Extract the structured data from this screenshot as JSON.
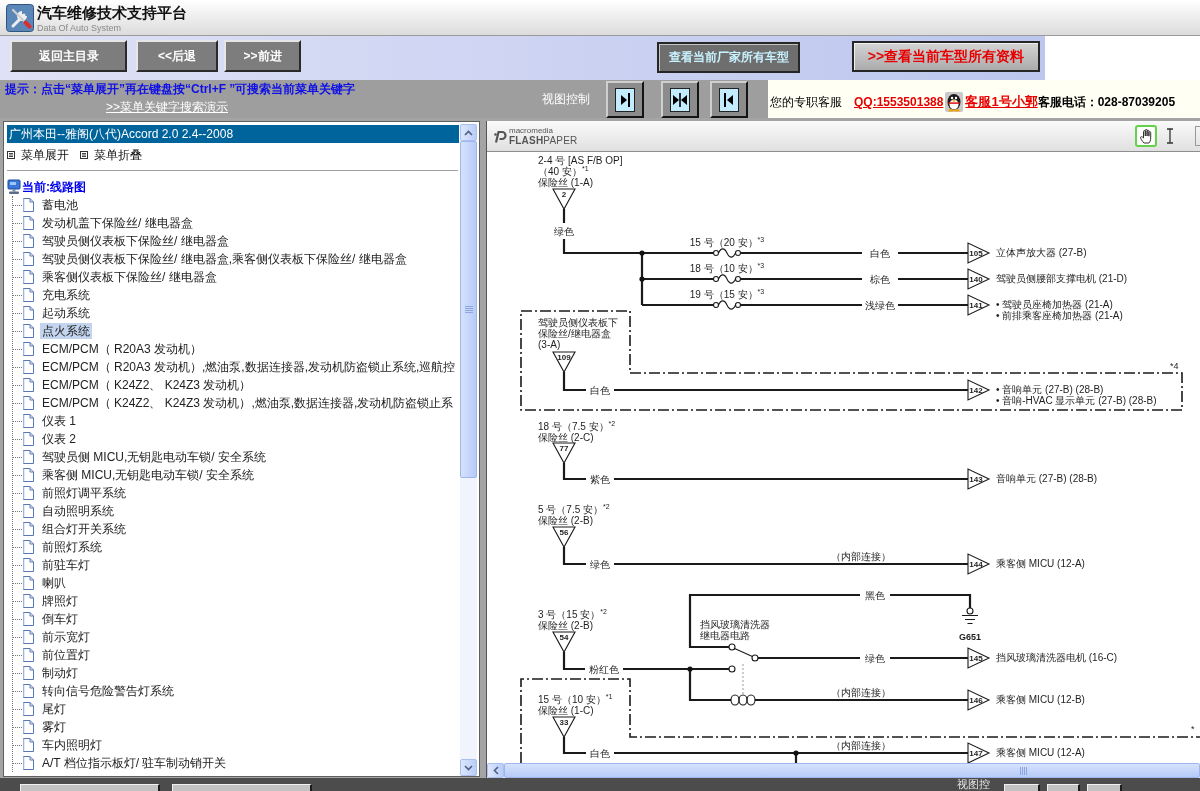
{
  "header": {
    "title": "汽车维修技术支持平台",
    "subtitle": "Data Of Auto System"
  },
  "nav": {
    "buttons": [
      "返回主目录",
      "<<后退",
      ">>前进"
    ],
    "links": [
      {
        "label": "查看当前厂家所有车型",
        "kind": "plain"
      },
      {
        "label": ">>查看当前车型所有资料",
        "kind": "highlight"
      }
    ]
  },
  "tip": {
    "text": "提示：点击“菜单展开”再在键盘按“Ctrl+F ”可搜索当前菜单关键字",
    "demo_link": ">>菜单关键字搜索演示"
  },
  "view_control": {
    "label": "视图控制",
    "buttons": [
      {
        "kind": "right"
      },
      {
        "kind": "center"
      },
      {
        "kind": "left"
      }
    ]
  },
  "support": {
    "label": "您的专职客服",
    "qq": "QQ:1553501388",
    "agent": "客服1号小郭",
    "phone_label": "客服电话：",
    "phone": "028-87039205"
  },
  "menu_panel": {
    "title": "广州本田--雅阁(八代)Accord 2.0 2.4--2008",
    "actions": [
      "菜单展开",
      "菜单折叠"
    ],
    "tree": {
      "label": "当前:线路图",
      "children": [
        {
          "label": "蓄电池",
          "selected": false
        },
        {
          "label": "发动机盖下保险丝/ 继电器盒",
          "selected": false
        },
        {
          "label": "驾驶员侧仪表板下保险丝/ 继电器盒",
          "selected": false
        },
        {
          "label": "驾驶员侧仪表板下保险丝/ 继电器盒,乘客侧仪表板下保险丝/ 继电器盒",
          "selected": false
        },
        {
          "label": "乘客侧仪表板下保险丝/ 继电器盒",
          "selected": false
        },
        {
          "label": "充电系统",
          "selected": false
        },
        {
          "label": "起动系统",
          "selected": false
        },
        {
          "label": "点火系统",
          "selected": true
        },
        {
          "label": "ECM/PCM（ R20A3 发动机）",
          "selected": false
        },
        {
          "label": "ECM/PCM（ R20A3 发动机）,燃油泵,数据连接器,发动机防盗锁止系统,巡航控",
          "selected": false
        },
        {
          "label": "ECM/PCM（ K24Z2、 K24Z3 发动机）",
          "selected": false
        },
        {
          "label": "ECM/PCM（ K24Z2、 K24Z3 发动机）,燃油泵,数据连接器,发动机防盗锁止系",
          "selected": false
        },
        {
          "label": "仪表 1",
          "selected": false
        },
        {
          "label": "仪表 2",
          "selected": false
        },
        {
          "label": "驾驶员侧 MICU,无钥匙电动车锁/ 安全系统",
          "selected": false
        },
        {
          "label": "乘客侧 MICU,无钥匙电动车锁/ 安全系统",
          "selected": false
        },
        {
          "label": "前照灯调平系统",
          "selected": false
        },
        {
          "label": "自动照明系统",
          "selected": false
        },
        {
          "label": "组合灯开关系统",
          "selected": false
        },
        {
          "label": "前照灯系统",
          "selected": false
        },
        {
          "label": "前驻车灯",
          "selected": false
        },
        {
          "label": "喇叭",
          "selected": false
        },
        {
          "label": "牌照灯",
          "selected": false
        },
        {
          "label": "倒车灯",
          "selected": false
        },
        {
          "label": "前示宽灯",
          "selected": false
        },
        {
          "label": "前位置灯",
          "selected": false
        },
        {
          "label": "制动灯",
          "selected": false
        },
        {
          "label": "转向信号危险警告灯系统",
          "selected": false
        },
        {
          "label": "尾灯",
          "selected": false
        },
        {
          "label": "雾灯",
          "selected": false
        },
        {
          "label": "车内照明灯",
          "selected": false
        },
        {
          "label": "A/T 档位指示板灯/ 驻车制动销开关",
          "selected": false
        }
      ]
    }
  },
  "viewer": {
    "brand": {
      "top": "macromedia",
      "bottom": "**FLASH**PAPER"
    },
    "tools": [
      {
        "kind": "hand",
        "selected": true
      },
      {
        "kind": "text",
        "selected": false
      }
    ],
    "diagram": {
      "sources": [
        {
          "lines": [
            "2-4 号 [AS F/B OP]",
            "（40 安）$^{*1}$",
            "保险丝 (1-A)"
          ],
          "pin": "2",
          "wire_color": "绿色"
        },
        {
          "lines": [
            "驾驶员侧仪表板下",
            "保险丝/继电器盒",
            "(3-A)"
          ],
          "pin": "109",
          "wire_color": "白色"
        },
        {
          "lines": [
            "18 号（7.5 安）$^{*2}$",
            "保险丝 (2-C)"
          ],
          "pin": "77",
          "wire_color": "紫色"
        },
        {
          "lines": [
            "5 号（7.5 安）$^{*2}$",
            "保险丝 (2-B)"
          ],
          "pin": "56",
          "wire_color": "绿色"
        },
        {
          "lines": [
            "3 号（15 安）$^{*2}$",
            "保险丝 (2-B)"
          ],
          "pin": "54",
          "wire_color": "粉红色"
        },
        {
          "lines": [
            "15 号（10 安）$^{*1}$",
            "保险丝 (1-C)"
          ],
          "pin": "33",
          "wire_color": "白色"
        }
      ],
      "branch_fuses": [
        "15 号（20 安）$^{*3}$",
        "18 号（10 安）$^{*3}$",
        "19 号（15 安）$^{*3}$"
      ],
      "outputs": [
        {
          "pin": "105",
          "wire_color": "白色",
          "loads": [
            "立体声放大器 (27-B)"
          ]
        },
        {
          "pin": "140",
          "wire_color": "棕色",
          "loads": [
            "驾驶员侧腰部支撑电机 (21-D)"
          ]
        },
        {
          "pin": "141",
          "wire_color": "浅绿色",
          "loads": [
            "• 驾驶员座椅加热器 (21-A)",
            "• 前排乘客座椅加热器 (21-A)"
          ]
        },
        {
          "pin": "142",
          "loads": [
            "• 音响单元 (27-B) (28-B)",
            "• 音响-HVAC 显示单元 (27-B) (28-B)"
          ]
        },
        {
          "pin": "143",
          "loads": [
            "音响单元 (27-B) (28-B)"
          ]
        },
        {
          "pin": "144",
          "note": "（内部连接）",
          "loads": [
            "乘客侧 MICU (12-A)"
          ]
        },
        {
          "pin": "145",
          "wire_color": "绿色",
          "loads": [
            "挡风玻璃清洗器电机 (16-C)"
          ]
        },
        {
          "pin": "146",
          "note": "（内部连接）",
          "loads": [
            "乘客侧 MICU (12-B)"
          ]
        },
        {
          "pin": "147",
          "note": "（内部连接）",
          "loads": [
            "乘客侧 MICU (12-A)"
          ]
        }
      ],
      "ground": {
        "wire_color": "黑色",
        "label": "G651"
      },
      "relay": {
        "lines": [
          "挡风玻璃清洗器",
          "继电器电路"
        ]
      },
      "notes": [
        "*4",
        "*"
      ]
    }
  },
  "bottom_bar": {
    "label": "视图控"
  }
}
